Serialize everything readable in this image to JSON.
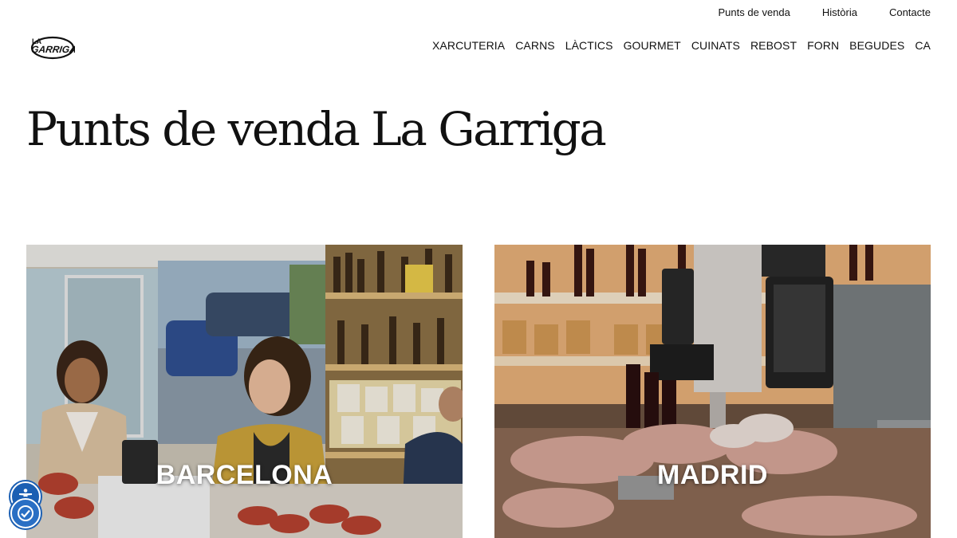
{
  "header": {
    "logo_alt": "La Garriga",
    "top_links": [
      "Punts de venda",
      "Història",
      "Contacte"
    ],
    "nav": [
      "XARCUTERIA",
      "CARNS",
      "LÀCTICS",
      "GOURMET",
      "CUINATS",
      "REBOST",
      "FORN",
      "BEGUDES",
      "CA"
    ]
  },
  "main": {
    "title": "Punts de venda La Garriga",
    "cards": [
      {
        "label": "BARCELONA"
      },
      {
        "label": "MADRID"
      }
    ]
  },
  "icons": {
    "accessibility": "accessibility-person-icon",
    "accessibility_alt": "accessibility-check-icon"
  },
  "colors": {
    "accent": "#1b5fb3"
  }
}
